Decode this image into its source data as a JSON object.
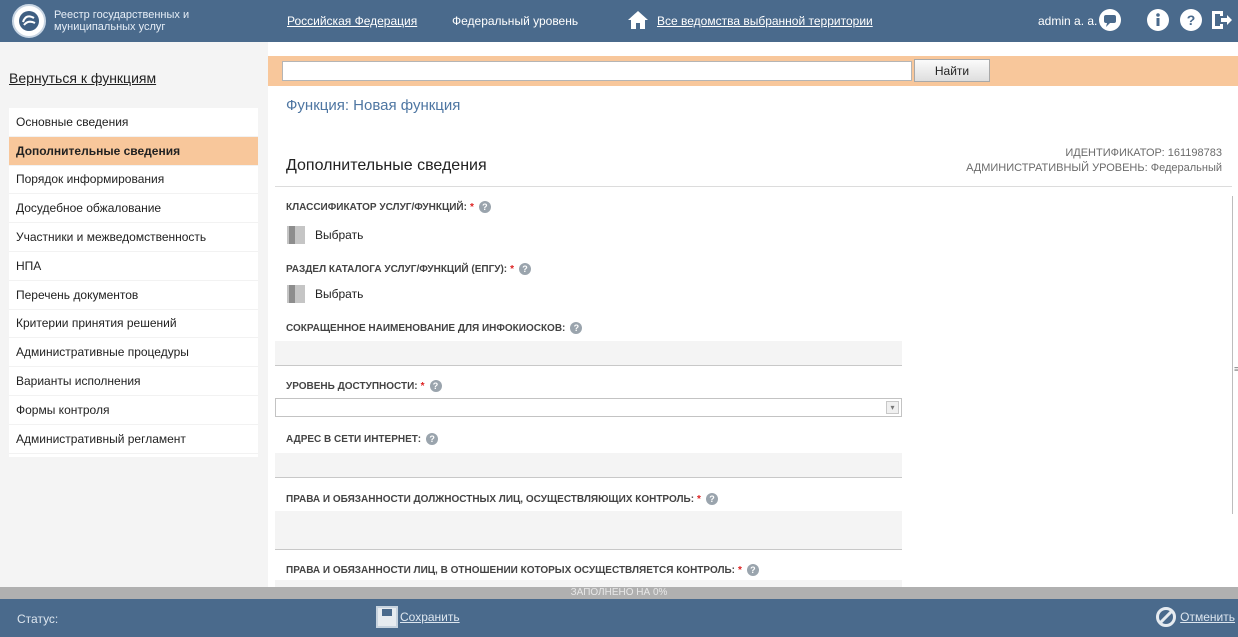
{
  "header": {
    "logo_text": "Реестр государственных и муниципальных услуг",
    "nav_federation": "Российская Федерация",
    "nav_level": "Федеральный уровень",
    "nav_departments": "Все ведомства выбранной территории",
    "user": "admin a. a."
  },
  "search": {
    "button": "Найти",
    "value": ""
  },
  "sidebar": {
    "back_link": "Вернуться к функциям",
    "items": [
      {
        "label": "Основные сведения"
      },
      {
        "label": "Дополнительные сведения"
      },
      {
        "label": "Порядок информирования"
      },
      {
        "label": "Досудебное обжалование"
      },
      {
        "label": "Участники и межведомственность"
      },
      {
        "label": "НПА"
      },
      {
        "label": "Перечень документов"
      },
      {
        "label": "Критерии принятия решений"
      },
      {
        "label": "Административные процедуры"
      },
      {
        "label": "Варианты исполнения"
      },
      {
        "label": "Формы контроля"
      },
      {
        "label": "Административный регламент"
      }
    ],
    "active_index": 1
  },
  "main": {
    "function_title": "Функция: Новая функция",
    "section_title": "Дополнительные сведения",
    "identifier": "ИДЕНТИФИКАТОР: 161198783",
    "admin_level": "АДМИНИСТРАТИВНЫЙ УРОВЕНЬ: Федеральный",
    "fields": {
      "classifier": "КЛАССИФИКАТОР УСЛУГ/ФУНКЦИЙ:",
      "catalog": "РАЗДЕЛ КАТАЛОГА УСЛУГ/ФУНКЦИЙ (ЕПГУ):",
      "short_name": "СОКРАЩЕННОЕ НАИМЕНОВАНИЕ ДЛЯ ИНФОКИОСКОВ:",
      "availability": "УРОВЕНЬ ДОСТУПНОСТИ:",
      "web_address": "АДРЕС В СЕТИ ИНТЕРНЕТ:",
      "officials_rights": "ПРАВА И ОБЯЗАННОСТИ ДОЛЖНОСТНЫХ ЛИЦ, ОСУЩЕСТВЛЯЮЩИХ КОНТРОЛЬ:",
      "controlled_rights": "ПРАВА И ОБЯЗАННОСТИ ЛИЦ, В ОТНОШЕНИИ КОТОРЫХ ОСУЩЕСТВЛЯЕТСЯ КОНТРОЛЬ:"
    },
    "select_label": "Выбрать",
    "required_mark": "*",
    "help_mark": "?"
  },
  "footer": {
    "progress_text": "ЗАПОЛНЕНО НА 0%",
    "progress_percent": 0,
    "status_label": "Статус:",
    "save": "Сохранить",
    "cancel": "Отменить"
  },
  "colors": {
    "header": "#4a6a8c",
    "accent": "#f8c79b",
    "title": "#4e76a2"
  }
}
